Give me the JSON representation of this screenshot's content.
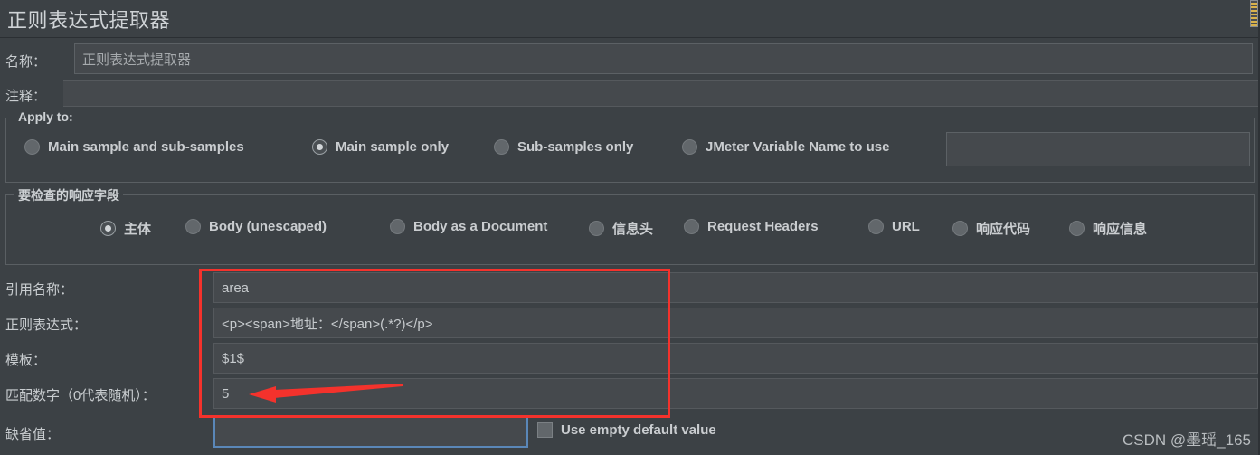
{
  "window": {
    "title": "正则表达式提取器"
  },
  "name_row": {
    "label": "名称：",
    "value": "正则表达式提取器"
  },
  "comment_row": {
    "label": "注释：",
    "value": ""
  },
  "apply_to": {
    "group_title": "Apply to:",
    "options": [
      {
        "label": "Main sample and sub-samples",
        "selected": false
      },
      {
        "label": "Main sample only",
        "selected": true
      },
      {
        "label": "Sub-samples only",
        "selected": false
      },
      {
        "label": "JMeter Variable Name to use",
        "selected": false
      }
    ],
    "variable_input_value": ""
  },
  "response_field": {
    "group_title": "要检查的响应字段",
    "options": [
      {
        "label": "主体",
        "selected": true
      },
      {
        "label": "Body (unescaped)",
        "selected": false
      },
      {
        "label": "Body as a Document",
        "selected": false
      },
      {
        "label": "信息头",
        "selected": false
      },
      {
        "label": "Request Headers",
        "selected": false
      },
      {
        "label": "URL",
        "selected": false
      },
      {
        "label": "响应代码",
        "selected": false
      },
      {
        "label": "响应信息",
        "selected": false
      }
    ]
  },
  "parameters": [
    {
      "label": "引用名称：",
      "value": "area"
    },
    {
      "label": "正则表达式：",
      "value": "<p><span>地址：</span>(.*?)</p>"
    },
    {
      "label": "模板：",
      "value": "$1$"
    },
    {
      "label": "匹配数字（0代表随机）：",
      "value": "5"
    }
  ],
  "default_value_row": {
    "label": "缺省值：",
    "value": "",
    "checkbox_label": "Use empty default value",
    "checkbox_checked": false
  },
  "annotations": {
    "highlight_color": "#f4322c",
    "arrow_color": "#f4322c",
    "focus_border_color": "#5a87b8"
  },
  "watermark": {
    "text": "CSDN @墨瑶_165"
  }
}
